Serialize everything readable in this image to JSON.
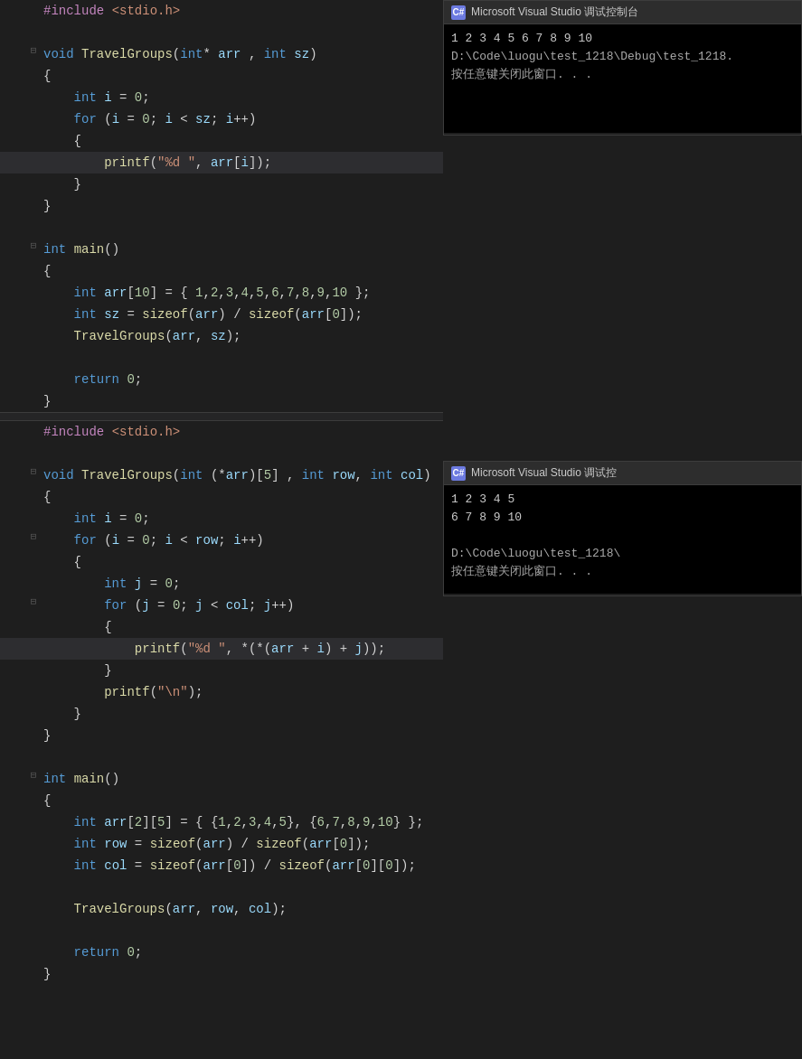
{
  "console1": {
    "title": "Microsoft Visual Studio 调试控制台",
    "icon_label": "C#",
    "lines": [
      "1 2 3 4 5 6 7 8 9 10",
      "D:\\Code\\luogu\\test_1218\\Debug\\test_1218.",
      "按任意键关闭此窗口. . ."
    ]
  },
  "console2": {
    "title": "Microsoft Visual Studio 调试控",
    "icon_label": "C#",
    "lines": [
      "1 2 3 4 5",
      "6 7 8 9 10",
      "",
      "D:\\Code\\luogu\\test_1218\\",
      "按任意键关闭此窗口. . ."
    ]
  },
  "code_block1": {
    "label": "first-code-block",
    "lines": [
      {
        "indent": "",
        "content": "#include <stdio.h>",
        "type": "pp",
        "collapse": "",
        "highlighted": false
      },
      {
        "indent": "",
        "content": "",
        "type": "plain",
        "collapse": "",
        "highlighted": false
      },
      {
        "indent": "",
        "content": "void TravelGroups(int* arr , int sz)",
        "type": "fn_decl",
        "collapse": "⊟",
        "highlighted": false
      },
      {
        "indent": "",
        "content": "{",
        "type": "plain",
        "collapse": "",
        "highlighted": false
      },
      {
        "indent": "    ",
        "content": "int i = 0;",
        "type": "stmt",
        "collapse": "",
        "highlighted": false
      },
      {
        "indent": "    ",
        "content": "for (i = 0; i < sz; i++)",
        "type": "stmt",
        "collapse": "",
        "highlighted": false
      },
      {
        "indent": "    ",
        "content": "{",
        "type": "plain",
        "collapse": "",
        "highlighted": false
      },
      {
        "indent": "        ",
        "content": "printf(\"%d \", arr[i]);",
        "type": "stmt",
        "collapse": "",
        "highlighted": true
      },
      {
        "indent": "    ",
        "content": "}",
        "type": "plain",
        "collapse": "",
        "highlighted": false
      },
      {
        "indent": "",
        "content": "}",
        "type": "plain",
        "collapse": "",
        "highlighted": false
      },
      {
        "indent": "",
        "content": "",
        "type": "plain",
        "collapse": "",
        "highlighted": false
      },
      {
        "indent": "",
        "content": "int main()",
        "type": "fn_decl",
        "collapse": "⊟",
        "highlighted": false
      },
      {
        "indent": "",
        "content": "{",
        "type": "plain",
        "collapse": "",
        "highlighted": false
      },
      {
        "indent": "    ",
        "content": "int arr[10] = { 1,2,3,4,5,6,7,8,9,10 };",
        "type": "stmt",
        "collapse": "",
        "highlighted": false
      },
      {
        "indent": "    ",
        "content": "int sz = sizeof(arr) / sizeof(arr[0]);",
        "type": "stmt",
        "collapse": "",
        "highlighted": false
      },
      {
        "indent": "    ",
        "content": "TravelGroups(arr, sz);",
        "type": "stmt",
        "collapse": "",
        "highlighted": false
      },
      {
        "indent": "",
        "content": "",
        "type": "plain",
        "collapse": "",
        "highlighted": false
      },
      {
        "indent": "    ",
        "content": "return 0;",
        "type": "stmt",
        "collapse": "",
        "highlighted": false
      },
      {
        "indent": "",
        "content": "}",
        "type": "plain",
        "collapse": "",
        "highlighted": false
      }
    ]
  },
  "code_block2": {
    "label": "second-code-block",
    "lines": [
      {
        "indent": "",
        "content": "#include <stdio.h>",
        "type": "pp",
        "collapse": "",
        "highlighted": false
      },
      {
        "indent": "",
        "content": "",
        "type": "plain",
        "collapse": "",
        "highlighted": false
      },
      {
        "indent": "",
        "content": "void TravelGroups(int (*arr)[5] , int row, int col)",
        "type": "fn_decl",
        "collapse": "⊟",
        "highlighted": false
      },
      {
        "indent": "",
        "content": "{",
        "type": "plain",
        "collapse": "",
        "highlighted": false
      },
      {
        "indent": "    ",
        "content": "int i = 0;",
        "type": "stmt",
        "collapse": "",
        "highlighted": false
      },
      {
        "indent": "    ",
        "content": "for (i = 0; i < row; i++)",
        "type": "stmt",
        "collapse": "⊟",
        "highlighted": false
      },
      {
        "indent": "    ",
        "content": "{",
        "type": "plain",
        "collapse": "",
        "highlighted": false
      },
      {
        "indent": "        ",
        "content": "int j = 0;",
        "type": "stmt",
        "collapse": "",
        "highlighted": false
      },
      {
        "indent": "        ",
        "content": "for (j = 0; j < col; j++)",
        "type": "stmt",
        "collapse": "⊟",
        "highlighted": false
      },
      {
        "indent": "        ",
        "content": "{",
        "type": "plain",
        "collapse": "",
        "highlighted": false
      },
      {
        "indent": "            ",
        "content": "printf(\"%d \", *(*(arr + i) + j));",
        "type": "stmt",
        "collapse": "",
        "highlighted": true
      },
      {
        "indent": "        ",
        "content": "}",
        "type": "plain",
        "collapse": "",
        "highlighted": false
      },
      {
        "indent": "        ",
        "content": "printf(\"\\n\");",
        "type": "stmt",
        "collapse": "",
        "highlighted": false
      },
      {
        "indent": "    ",
        "content": "}",
        "type": "plain",
        "collapse": "",
        "highlighted": false
      },
      {
        "indent": "",
        "content": "}",
        "type": "plain",
        "collapse": "",
        "highlighted": false
      },
      {
        "indent": "",
        "content": "",
        "type": "plain",
        "collapse": "",
        "highlighted": false
      },
      {
        "indent": "",
        "content": "int main()",
        "type": "fn_decl",
        "collapse": "⊟",
        "highlighted": false
      },
      {
        "indent": "",
        "content": "{",
        "type": "plain",
        "collapse": "",
        "highlighted": false
      },
      {
        "indent": "    ",
        "content": "int arr[2][5] = { {1,2,3,4,5}, {6,7,8,9,10} };",
        "type": "stmt",
        "collapse": "",
        "highlighted": false
      },
      {
        "indent": "    ",
        "content": "int row = sizeof(arr) / sizeof(arr[0]);",
        "type": "stmt",
        "collapse": "",
        "highlighted": false
      },
      {
        "indent": "    ",
        "content": "int col = sizeof(arr[0]) / sizeof(arr[0][0]);",
        "type": "stmt",
        "collapse": "",
        "highlighted": false
      },
      {
        "indent": "",
        "content": "",
        "type": "plain",
        "collapse": "",
        "highlighted": false
      },
      {
        "indent": "    ",
        "content": "TravelGroups(arr, row, col);",
        "type": "stmt",
        "collapse": "",
        "highlighted": false
      },
      {
        "indent": "",
        "content": "",
        "type": "plain",
        "collapse": "",
        "highlighted": false
      },
      {
        "indent": "    ",
        "content": "return 0;",
        "type": "stmt",
        "collapse": "",
        "highlighted": false
      },
      {
        "indent": "",
        "content": "}",
        "type": "plain",
        "collapse": "",
        "highlighted": false
      }
    ]
  }
}
